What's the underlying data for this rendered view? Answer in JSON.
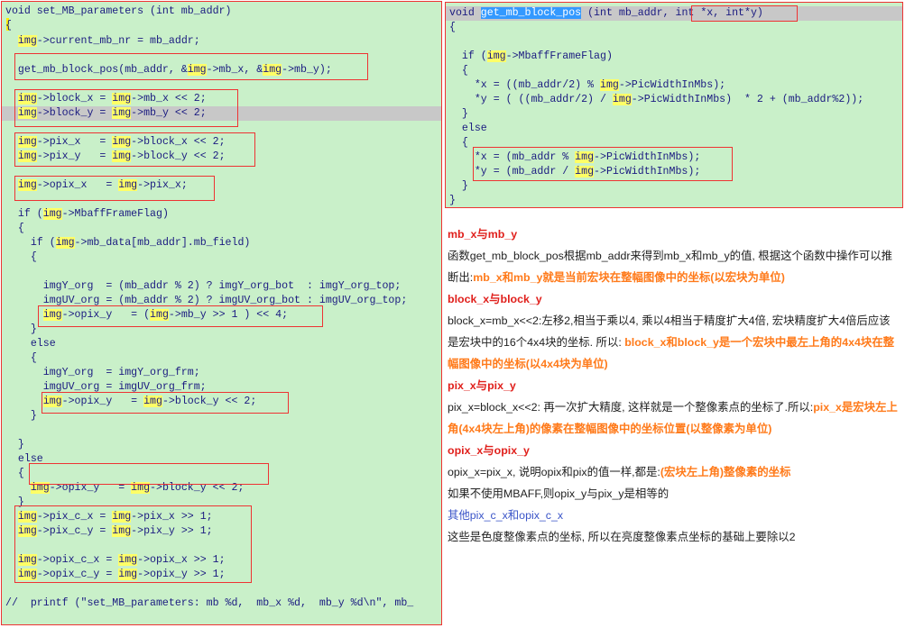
{
  "left_code": [
    "void set_MB_parameters (int mb_addr)",
    "{",
    "  img->current_mb_nr = mb_addr;",
    "  get_mb_block_pos(mb_addr, &img->mb_x, &img->mb_y);",
    "  img->block_x = img->mb_x << 2;",
    "  img->block_y = img->mb_y << 2;",
    "  img->pix_x   = img->block_x << 2;",
    "  img->pix_y   = img->block_y << 2;",
    "  img->opix_x   = img->pix_x;",
    "  if (img->MbaffFrameFlag)",
    "  {",
    "    if (img->mb_data[mb_addr].mb_field)",
    "    {",
    "      imgY_org  = (mb_addr % 2) ? imgY_org_bot  : imgY_org_top;",
    "      imgUV_org = (mb_addr % 2) ? imgUV_org_bot : imgUV_org_top;",
    "      img->opix_y   = (img->mb_y >> 1 ) << 4;",
    "    }",
    "    else",
    "    {",
    "      imgY_org  = imgY_org_frm;",
    "      imgUV_org = imgUV_org_frm;",
    "      img->opix_y   = img->block_y << 2;",
    "    }",
    "  }",
    "  else",
    "  {",
    "    img->opix_y   = img->block_y << 2;",
    "  }",
    "  img->pix_c_x = img->pix_x >> 1;",
    "  img->pix_c_y = img->pix_y >> 1;",
    "  img->opix_c_x = img->opix_x >> 1;",
    "  img->opix_c_y = img->opix_y >> 1;",
    "//  printf (\"set_MB_parameters: mb %d,  mb_x %d,  mb_y %d\\n\", mb_"
  ],
  "right_code": [
    "void get_mb_block_pos (int mb_addr, int *x, int*y)",
    "{",
    "  if (img->MbaffFrameFlag)",
    "  {",
    "    *x = ((mb_addr/2) % img->PicWidthInMbs);",
    "    *y = ( ((mb_addr/2) / img->PicWidthInMbs)  * 2 + (mb_addr%2));",
    "  }",
    "  else",
    "  {",
    "    *x = (mb_addr % img->PicWidthInMbs);",
    "    *y = (mb_addr / img->PicWidthInMbs);",
    "  }",
    "}"
  ],
  "notes": {
    "h1": "mb_x与mb_y",
    "p1a": "函数get_mb_block_pos根据mb_addr来得到mb_x和mb_y的值, 根据这个函数中操作可以推",
    "p1b_pre": "断出:",
    "p1b_em": "mb_x和mb_y就是当前宏块在整幅图像中的坐标(以宏块为单位)",
    "h2": "block_x与block_y",
    "p2a": "block_x=mb_x<<2:左移2,相当于乘以4, 乘以4相当于精度扩大4倍, 宏块精度扩大4倍后应该",
    "p2b_pre": "是宏块中的16个4x4块的坐标. 所以: ",
    "p2b_em": "block_x和block_y是一个宏块中最左上角的4x4块在整",
    "p2c_em": "幅图像中的坐标(以4x4块为单位)",
    "h3": "pix_x与pix_y",
    "p3a_pre": "pix_x=block_x<<2: 再一次扩大精度, 这样就是一个整像素点的坐标了.所以:",
    "p3a_em": "pix_x是宏块左上",
    "p3b_em": "角(4x4块左上角)的像素在整幅图像中的坐标位置(以整像素为单位)",
    "h4": "opix_x与opix_y",
    "p4a_pre": "opix_x=pix_x, 说明opix和pix的值一样,都是:",
    "p4a_em": "(宏块左上角)整像素的坐标",
    "p4b": "如果不使用MBAFF,则opix_y与pix_y是相等的",
    "h5": "其他pix_c_x和opix_c_x",
    "p5": "这些是色度整像素点的坐标, 所以在亮度整像素点坐标的基础上要除以2"
  }
}
